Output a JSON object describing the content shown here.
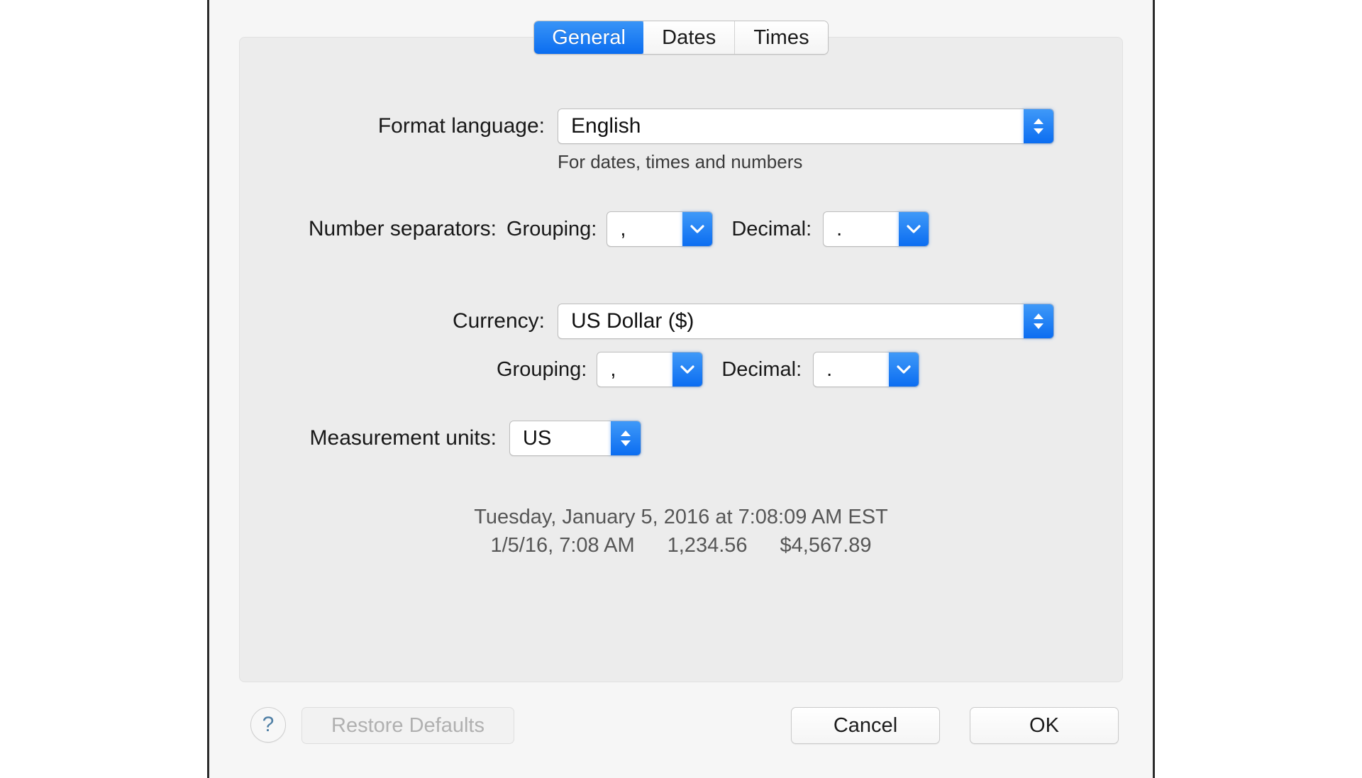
{
  "window": {
    "tabs": [
      {
        "label": "General",
        "selected": true
      },
      {
        "label": "Dates",
        "selected": false
      },
      {
        "label": "Times",
        "selected": false
      }
    ]
  },
  "form": {
    "format_language": {
      "label": "Format language:",
      "value": "English",
      "hint": "For dates, times and numbers"
    },
    "number_separators": {
      "label": "Number separators:",
      "grouping_label": "Grouping:",
      "grouping_value": ",",
      "decimal_label": "Decimal:",
      "decimal_value": "."
    },
    "currency": {
      "label": "Currency:",
      "value": "US Dollar ($)",
      "grouping_label": "Grouping:",
      "grouping_value": ",",
      "decimal_label": "Decimal:",
      "decimal_value": "."
    },
    "measurement_units": {
      "label": "Measurement units:",
      "value": "US"
    }
  },
  "preview": {
    "line1": "Tuesday, January 5, 2016 at 7:08:09 AM EST",
    "line2_date_time": "1/5/16, 7:08 AM",
    "line2_number": "1,234.56",
    "line2_currency": "$4,567.89"
  },
  "buttons": {
    "help": "?",
    "restore_defaults": "Restore Defaults",
    "cancel": "Cancel",
    "ok": "OK"
  },
  "colors": {
    "accent_blue": "#0b6df1",
    "tab_selected_blue": "#1f7ef5",
    "panel_gray": "#ececec",
    "window_gray": "#f6f6f6",
    "preview_text": "#565656",
    "disabled_text": "#b0b0b0",
    "help_glyph": "#4f7fa5"
  }
}
